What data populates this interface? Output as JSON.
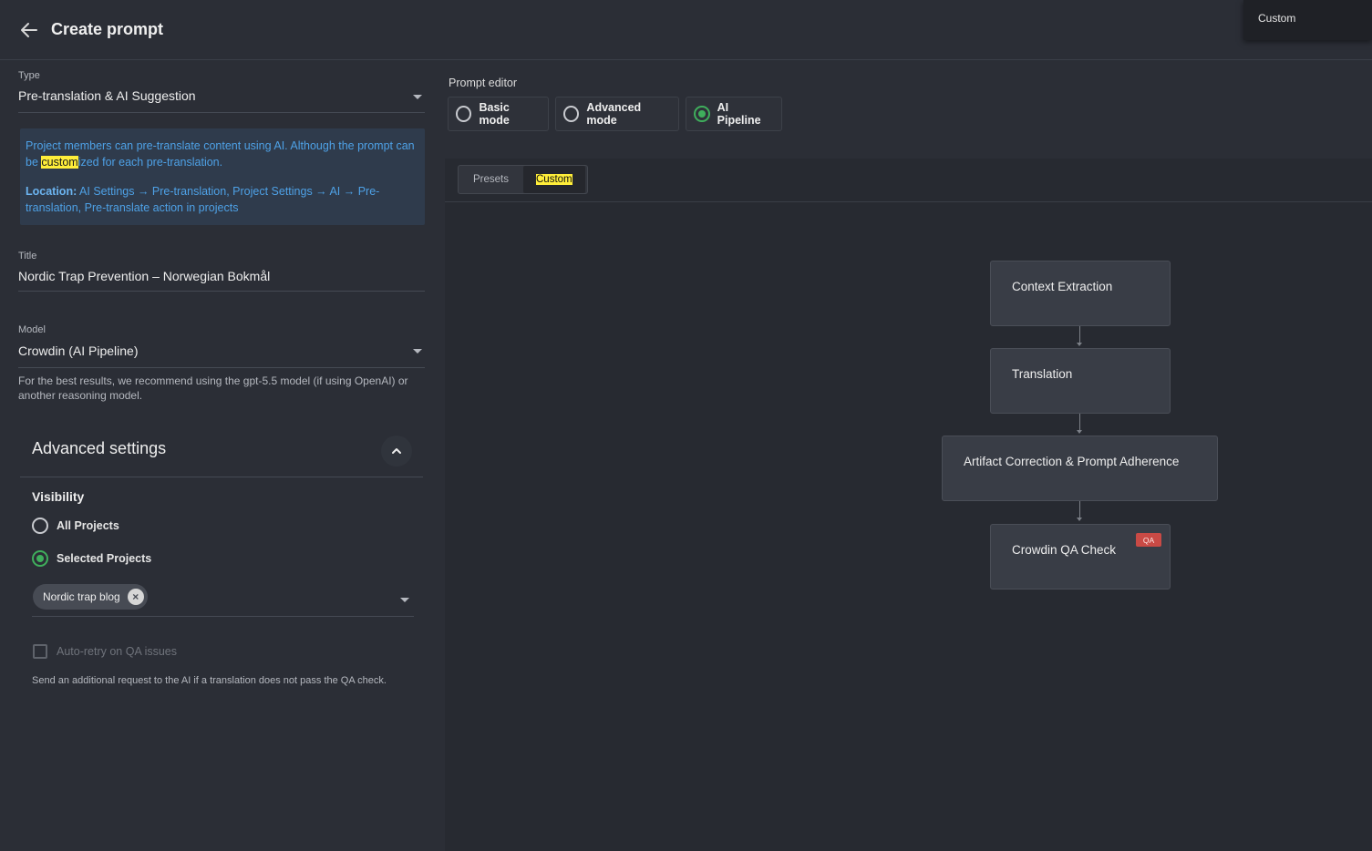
{
  "header": {
    "title": "Create prompt",
    "tooltip": "Custom"
  },
  "form": {
    "type": {
      "label": "Type",
      "value": "Pre-translation & AI Suggestion"
    },
    "info": {
      "line1_a": "Project members can pre-translate content using AI. Although the prompt can be ",
      "line1_hl": "custom",
      "line1_b": "ized for each pre-translation.",
      "location_label": "Location:",
      "location_text": " AI Settings → Pre-translation, Project Settings → AI → Pre-translation, Pre-translate action in projects"
    },
    "title": {
      "label": "Title",
      "value": "Nordic Trap Prevention – Norwegian Bokmål"
    },
    "model": {
      "label": "Model",
      "value": "Crowdin (AI Pipeline)",
      "helper": "For the best results, we recommend using the gpt-5.5 model (if using OpenAI) or another reasoning model."
    }
  },
  "advanced": {
    "title": "Advanced settings",
    "visibility_title": "Visibility",
    "options": [
      {
        "label": "All Projects",
        "selected": false
      },
      {
        "label": "Selected Projects",
        "selected": true
      }
    ],
    "chip": "Nordic trap blog",
    "checkbox_label": "Auto-retry on QA issues",
    "checkbox_help": "Send an additional request to the AI if a translation does not pass the QA check."
  },
  "editor": {
    "label": "Prompt editor",
    "modes": [
      {
        "label": "Basic mode",
        "selected": false
      },
      {
        "label": "Advanced mode",
        "selected": false
      },
      {
        "label": "AI Pipeline",
        "selected": true
      }
    ],
    "tabs": {
      "presets": "Presets",
      "custom": "Custom",
      "active": "custom"
    },
    "pipeline": [
      {
        "label": "Context Extraction"
      },
      {
        "label": "Translation"
      },
      {
        "label": "Artifact Correction & Prompt Adherence"
      },
      {
        "label": "Crowdin QA Check",
        "badge": "QA"
      }
    ]
  },
  "colors": {
    "accent_green": "#3fae5c",
    "highlight_yellow": "#ffee3a",
    "info_blue": "#4ea1e6",
    "qa_badge_red": "#c94a45"
  }
}
